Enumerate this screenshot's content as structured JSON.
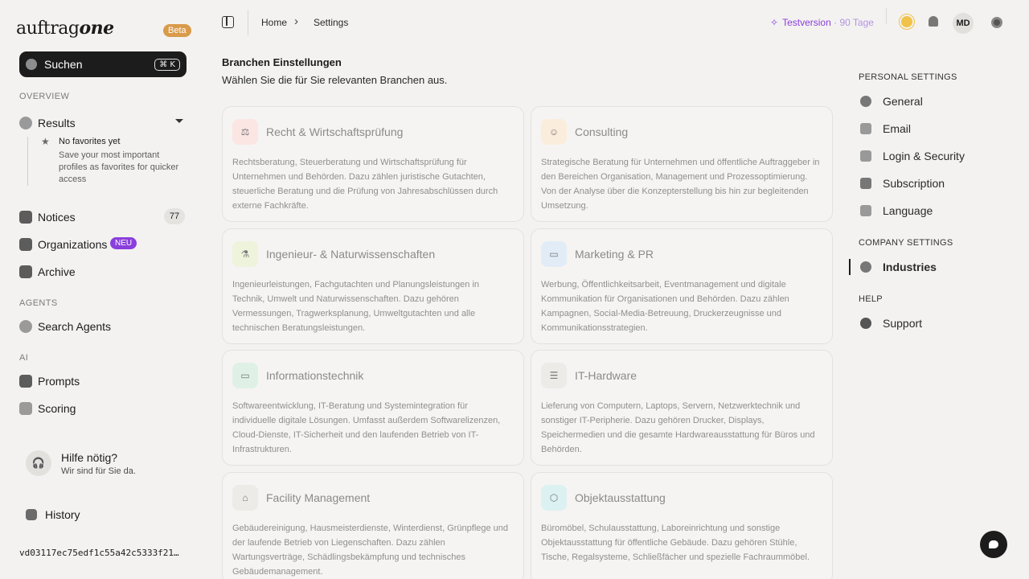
{
  "brand": {
    "name_a": "auftrag",
    "name_b": "one",
    "badge": "Beta"
  },
  "search": {
    "label": "Suchen",
    "shortcut": "⌘ K"
  },
  "sidebar": {
    "overview_label": "OVERVIEW",
    "results": "Results",
    "favorites": {
      "title": "No favorites yet",
      "desc": "Save your most important profiles as favorites for quicker access"
    },
    "notices": "Notices",
    "notices_count": "77",
    "organizations": "Organizations",
    "organizations_badge": "NEU",
    "archive": "Archive",
    "agents_label": "AGENTS",
    "search_agents": "Search Agents",
    "ai_label": "AI",
    "prompts": "Prompts",
    "scoring": "Scoring",
    "help_title": "Hilfe nötig?",
    "help_sub": "Wir sind für Sie da.",
    "history": "History",
    "hash": "vd03117ec75edf1c55a42c5333f21…"
  },
  "topbar": {
    "crumb_home": "Home",
    "crumb_settings": "Settings",
    "trial_label": "Testversion",
    "trial_sep": "·",
    "trial_days": "90 Tage",
    "avatar": "MD"
  },
  "main": {
    "title": "Branchen Einstellungen",
    "subtitle": "Wählen Sie die für Sie relevanten Branchen aus.",
    "cards": [
      {
        "title": "Recht & Wirtschaftsprüfung",
        "icon": "scale-icon",
        "desc": "Rechtsberatung, Steuerberatung und Wirtschaftsprüfung für Unternehmen und Behörden. Dazu zählen juristische Gutachten, steuerliche Beratung und die Prüfung von Jahresabschlüssen durch externe Fachkräfte."
      },
      {
        "title": "Consulting",
        "icon": "people-icon",
        "desc": "Strategische Beratung für Unternehmen und öffentliche Auftraggeber in den Bereichen Organisation, Management und Prozessoptimierung. Von der Analyse über die Konzepterstellung bis hin zur begleitenden Umsetzung."
      },
      {
        "title": "Ingenieur- & Naturwissenschaften",
        "icon": "flask-icon",
        "desc": "Ingenieurleistungen, Fachgutachten und Planungsleistungen in Technik, Umwelt und Naturwissenschaften. Dazu gehören Vermessungen, Tragwerksplanung, Umweltgutachten und alle technischen Beratungsleistungen."
      },
      {
        "title": "Marketing & PR",
        "icon": "megaphone-icon",
        "desc": "Werbung, Öffentlichkeitsarbeit, Eventmanagement und digitale Kommunikation für Organisationen und Behörden. Dazu zählen Kampagnen, Social-Media-Betreuung, Druckerzeugnisse und Kommunikationsstrategien."
      },
      {
        "title": "Informationstechnik",
        "icon": "monitor-icon",
        "desc": "Softwareentwicklung, IT-Beratung und Systemintegration für individuelle digitale Lösungen. Umfasst außerdem Softwarelizenzen, Cloud-Dienste, IT-Sicherheit und den laufenden Betrieb von IT-Infrastrukturen."
      },
      {
        "title": "IT-Hardware",
        "icon": "server-icon",
        "desc": "Lieferung von Computern, Laptops, Servern, Netzwerktechnik und sonstiger IT-Peripherie. Dazu gehören Drucker, Displays, Speichermedien und die gesamte Hardwareausstattung für Büros und Behörden."
      },
      {
        "title": "Facility Management",
        "icon": "house-icon",
        "desc": "Gebäudereinigung, Hausmeisterdienste, Winterdienst, Grünpflege und der laufende Betrieb von Liegenschaften. Dazu zählen Wartungsverträge, Schädlingsbekämpfung und technisches Gebäudemanagement."
      },
      {
        "title": "Objektausstattung",
        "icon": "box-icon",
        "desc": "Büromöbel, Schulausstattung, Laboreinrichtung und sonstige Objektausstattung für öffentliche Gebäude. Dazu gehören Stühle, Tische, Regalsysteme, Schließfächer und spezielle Fachraummöbel."
      }
    ]
  },
  "settings_nav": {
    "personal_label": "PERSONAL SETTINGS",
    "general": "General",
    "email": "Email",
    "login_security": "Login & Security",
    "subscription": "Subscription",
    "language": "Language",
    "company_label": "COMPANY SETTINGS",
    "industries": "Industries",
    "help_label": "HELP",
    "support": "Support"
  },
  "colors": {
    "accent": "#8a3fdc",
    "beta": "#d99a4a"
  }
}
